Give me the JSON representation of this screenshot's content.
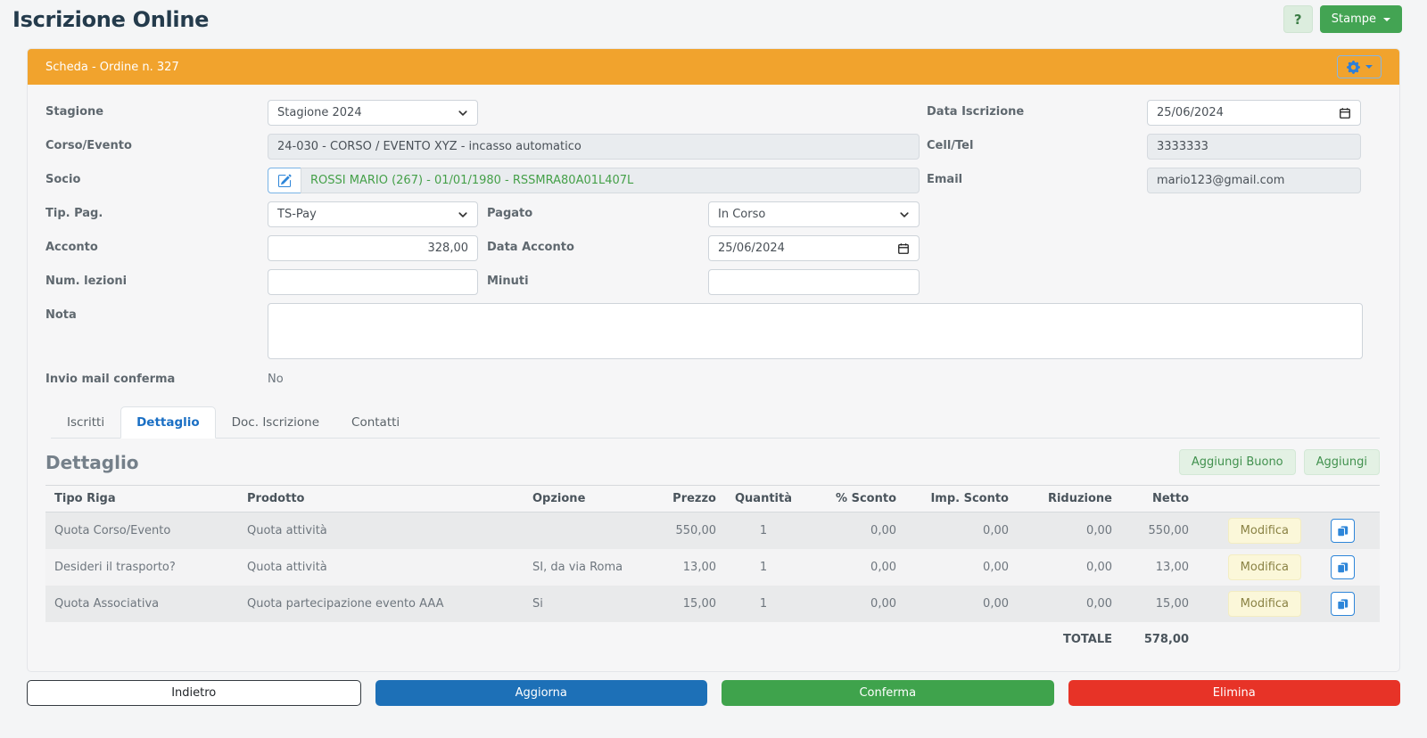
{
  "page": {
    "title": "Iscrizione Online",
    "help_label": "?",
    "stampe_label": "Stampe"
  },
  "card": {
    "header_title": "Scheda - Ordine n. 327"
  },
  "form": {
    "stagione": {
      "label": "Stagione",
      "value": "Stagione 2024"
    },
    "data_iscrizione": {
      "label": "Data Iscrizione",
      "value": "25/06/2024"
    },
    "corso_evento": {
      "label": "Corso/Evento",
      "value": "24-030 - CORSO / EVENTO XYZ - incasso automatico"
    },
    "cell_tel": {
      "label": "Cell/Tel",
      "value": "3333333"
    },
    "socio": {
      "label": "Socio",
      "value": "ROSSI MARIO (267) - 01/01/1980 - RSSMRA80A01L407L"
    },
    "email": {
      "label": "Email",
      "value": "mario123@gmail.com"
    },
    "tip_pag": {
      "label": "Tip. Pag.",
      "value": "TS-Pay"
    },
    "pagato": {
      "label": "Pagato",
      "value": "In Corso"
    },
    "acconto": {
      "label": "Acconto",
      "value": "328,00"
    },
    "data_acconto": {
      "label": "Data Acconto",
      "value": "25/06/2024"
    },
    "num_lezioni": {
      "label": "Num. lezioni",
      "value": ""
    },
    "minuti": {
      "label": "Minuti",
      "value": ""
    },
    "nota": {
      "label": "Nota",
      "value": ""
    },
    "invio_mail": {
      "label": "Invio mail conferma",
      "value": "No"
    }
  },
  "tabs": [
    {
      "label": "Iscritti",
      "active": false
    },
    {
      "label": "Dettaglio",
      "active": true
    },
    {
      "label": "Doc. Iscrizione",
      "active": false
    },
    {
      "label": "Contatti",
      "active": false
    }
  ],
  "dettaglio": {
    "heading": "Dettaglio",
    "aggiungi_buono_label": "Aggiungi Buono",
    "aggiungi_label": "Aggiungi",
    "table": {
      "headers": [
        "Tipo Riga",
        "Prodotto",
        "Opzione",
        "Prezzo",
        "Quantità",
        "% Sconto",
        "Imp. Sconto",
        "Riduzione",
        "Netto"
      ],
      "modifica_label": "Modifica",
      "rows": [
        {
          "tipo_riga": "Quota Corso/Evento",
          "prodotto": "Quota attività",
          "opzione": "",
          "prezzo": "550,00",
          "quantita": "1",
          "perc_sconto": "0,00",
          "imp_sconto": "0,00",
          "riduzione": "0,00",
          "netto": "550,00"
        },
        {
          "tipo_riga": "Desideri il trasporto?",
          "prodotto": "Quota attività",
          "opzione": "SI, da via Roma",
          "prezzo": "13,00",
          "quantita": "1",
          "perc_sconto": "0,00",
          "imp_sconto": "0,00",
          "riduzione": "0,00",
          "netto": "13,00"
        },
        {
          "tipo_riga": "Quota Associativa",
          "prodotto": "Quota partecipazione evento AAA",
          "opzione": "Si",
          "prezzo": "15,00",
          "quantita": "1",
          "perc_sconto": "0,00",
          "imp_sconto": "0,00",
          "riduzione": "0,00",
          "netto": "15,00"
        }
      ],
      "total_label": "TOTALE",
      "total_value": "578,00"
    }
  },
  "footer": {
    "indietro_label": "Indietro",
    "aggiorna_label": "Aggiorna",
    "conferma_label": "Conferma",
    "elimina_label": "Elimina"
  },
  "colors": {
    "header_orange": "#f1a32d",
    "primary_blue": "#1d70b7",
    "success_green": "#3fa34c",
    "danger_red": "#e73327",
    "tab_active_blue": "#1a6fc4",
    "socio_text_green": "#45a049",
    "modifica_yellow": "#fbf7d9"
  }
}
